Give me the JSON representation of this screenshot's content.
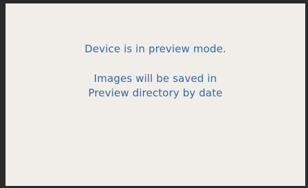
{
  "preview_notice": {
    "status": "Device is in preview mode.",
    "save_info_line1": "Images will be saved in",
    "save_info_line2": "Preview directory by date"
  },
  "colors": {
    "text": "#2f6aa6",
    "background": "#f1eeea",
    "frame": "#2a2a2a"
  }
}
